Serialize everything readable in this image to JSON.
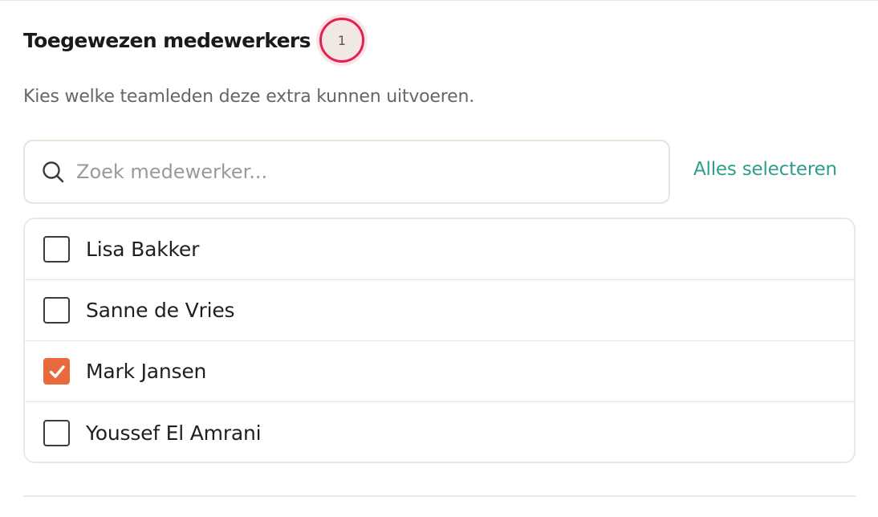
{
  "assigned_staff": {
    "title": "Toegewezen medewerkers",
    "count": "1",
    "description": "Kies welke teamleden deze extra kunnen uitvoeren.",
    "search": {
      "placeholder": "Zoek medewerker...",
      "value": ""
    },
    "select_all_label": "Alles selecteren",
    "members": [
      {
        "name": "Lisa Bakker",
        "checked": false
      },
      {
        "name": "Sanne de Vries",
        "checked": false
      },
      {
        "name": "Mark Jansen",
        "checked": true
      },
      {
        "name": "Youssef El Amrani",
        "checked": false
      }
    ]
  },
  "colors": {
    "accent_link": "#2f9d8a",
    "checkbox_checked": "#e8693b",
    "highlight_ring": "#e0224f"
  }
}
